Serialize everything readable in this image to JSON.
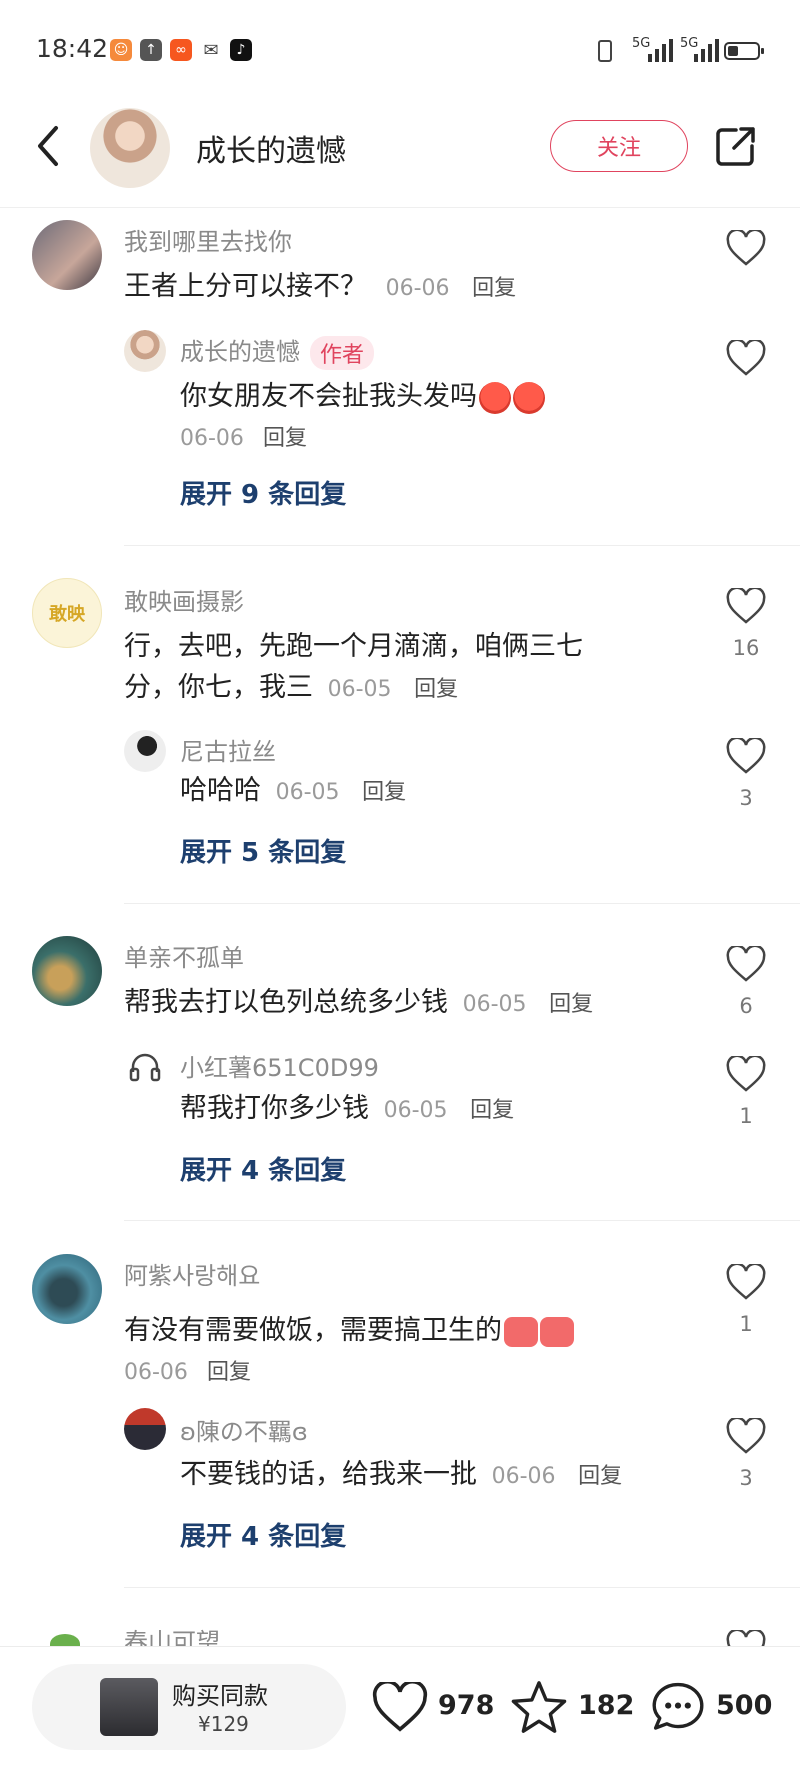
{
  "status_bar": {
    "time": "18:42",
    "app_icons": [
      "taobao-icon",
      "upload-icon",
      "kuaishou-icon",
      "wechat-icon",
      "tiktok-icon"
    ],
    "signal_label_1": "5G",
    "signal_label_2": "5G",
    "battery_level": 0.35
  },
  "header": {
    "title": "成长的遗憾",
    "follow_label": "关注"
  },
  "comments": [
    {
      "name": "我到哪里去找你",
      "text": "王者上分可以接不？",
      "date": "06-06",
      "reply_label": "回复",
      "likes": "",
      "sub": {
        "name": "成长的遗憾",
        "author_tag": "作者",
        "text": "你女朋友不会扯我头发吗",
        "date": "06-06",
        "reply_label": "回复",
        "likes": ""
      },
      "expand": "展开 9 条回复"
    },
    {
      "name": "敢映画摄影",
      "text_line1": "行，去吧，先跑一个月滴滴，咱俩三七",
      "text_line2": "分，你七，我三",
      "date": "06-05",
      "reply_label": "回复",
      "likes": "16",
      "sub": {
        "name": "尼古拉丝",
        "text": "哈哈哈",
        "date": "06-05",
        "reply_label": "回复",
        "likes": "3"
      },
      "expand": "展开 5 条回复"
    },
    {
      "name": "单亲不孤单",
      "text": "帮我去打以色列总统多少钱",
      "date": "06-05",
      "reply_label": "回复",
      "likes": "6",
      "sub": {
        "name": "小红薯651C0D99",
        "text": "帮我打你多少钱",
        "date": "06-05",
        "reply_label": "回复",
        "likes": "1"
      },
      "expand": "展开 4 条回复"
    },
    {
      "name": "阿紫사랑해요",
      "text": "有没有需要做饭，需要搞卫生的",
      "date": "06-06",
      "reply_label": "回复",
      "likes": "1",
      "sub": {
        "name": "ʚ陳の不羈ɞ",
        "text": "不要钱的话，给我来一批",
        "date": "06-06",
        "reply_label": "回复",
        "likes": "3"
      },
      "expand": "展开 4 条回复"
    },
    {
      "name": "春山可望"
    }
  ],
  "bottom_bar": {
    "buy_label": "购买同款",
    "price": "¥129",
    "likes": "978",
    "stars": "182",
    "comments": "500"
  },
  "colors": {
    "accent": "#e0445e",
    "expand_link": "#1d3f6e",
    "muted_text": "#8a8a8a"
  }
}
